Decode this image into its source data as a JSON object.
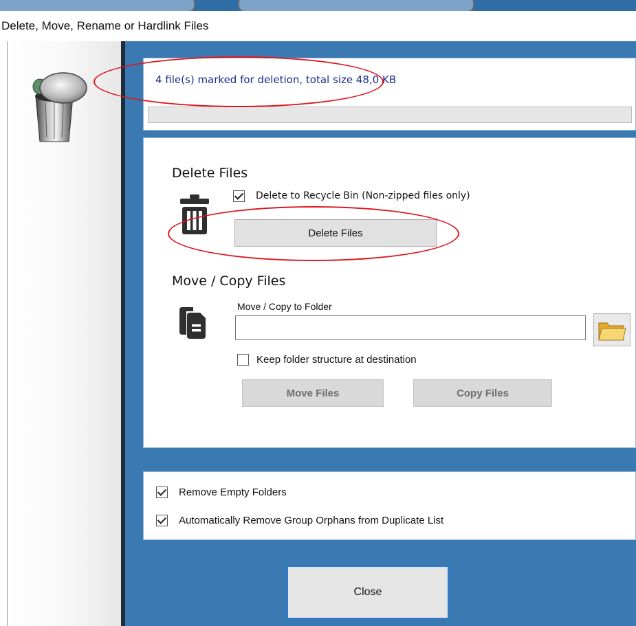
{
  "window": {
    "title": "Delete, Move, Rename or Hardlink Files"
  },
  "status": {
    "text": "4 file(s) marked for deletion, total size 48,0 KB",
    "progress": 0
  },
  "delete_section": {
    "heading": "Delete Files",
    "recycle_checkbox_label": "Delete to Recycle Bin (Non-zipped files only)",
    "recycle_checked": true,
    "button_label": "Delete Files",
    "icon": "trash-can-icon"
  },
  "move_section": {
    "heading": "Move / Copy Files",
    "folder_label": "Move / Copy to Folder",
    "folder_value": "",
    "keep_structure_label": "Keep folder structure at destination",
    "keep_structure_checked": false,
    "move_button_label": "Move Files",
    "copy_button_label": "Copy Files",
    "icons": [
      "copy-files-icon",
      "browse-folder-icon"
    ]
  },
  "options": {
    "remove_empty_label": "Remove Empty Folders",
    "remove_empty_checked": true,
    "remove_orphans_label": "Automatically Remove Group Orphans from Duplicate List",
    "remove_orphans_checked": true
  },
  "close_label": "Close",
  "colors": {
    "accent": "#3b79b2",
    "annotation": "#e0141b",
    "status_text": "#1d2a8c"
  }
}
